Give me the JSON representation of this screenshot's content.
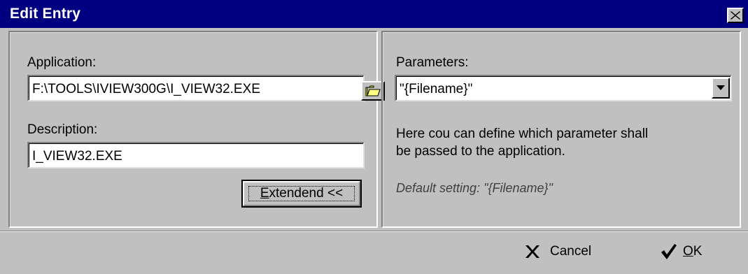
{
  "window": {
    "title": "Edit Entry"
  },
  "left": {
    "application_label": "Application:",
    "application_value": "F:\\TOOLS\\IVIEW300G\\I_VIEW32.EXE",
    "description_label": "Description:",
    "description_value": "I_VIEW32.EXE",
    "extend_label_first": "E",
    "extend_label_rest": "xtendend <<"
  },
  "right": {
    "parameters_label": "Parameters:",
    "parameters_value": "\"{Filename}\"",
    "help_line1": "Here cou can define which parameter shall",
    "help_line2": "be passed to the application.",
    "default_text": "Default setting: \"{Filename}\""
  },
  "footer": {
    "cancel_label": "Cancel",
    "ok_label_first": "O",
    "ok_label_rest": "K"
  },
  "icons": {
    "close": "close-icon",
    "folder": "folder-open-icon",
    "dropdown": "chevron-down-icon",
    "cancel": "x-icon",
    "ok": "checkmark-icon"
  },
  "colors": {
    "titlebar": "#000080",
    "face": "#c0c0c0",
    "folder_yellow": "#ffff00"
  }
}
